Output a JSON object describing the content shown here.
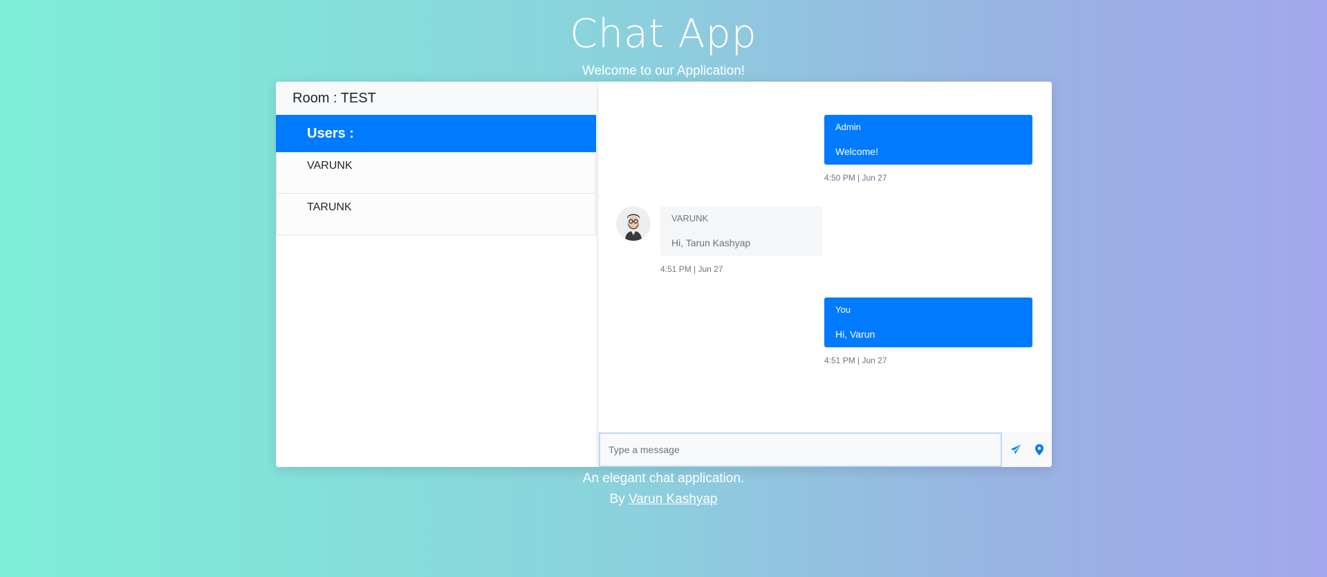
{
  "header": {
    "title": "Chat App",
    "subtitle": "Welcome to our Application!"
  },
  "sidebar": {
    "room_label": "Room : TEST",
    "users_label": "Users :",
    "users": [
      "VARUNK",
      "TARUNK"
    ]
  },
  "messages": [
    {
      "author": "Admin",
      "text": "Welcome!",
      "time": "4:50 PM | Jun 27",
      "direction": "outgoing"
    },
    {
      "author": "VARUNK",
      "text": "Hi, Tarun Kashyap",
      "time": "4:51 PM | Jun 27",
      "direction": "incoming",
      "avatar_icon": "bearded-man-avatar-icon"
    },
    {
      "author": "You",
      "text": "Hi, Varun",
      "time": "4:51 PM | Jun 27",
      "direction": "outgoing"
    }
  ],
  "composer": {
    "placeholder": "Type a message",
    "send_icon": "paper-plane-icon",
    "location_icon": "map-pin-icon"
  },
  "footer": {
    "tagline": "An elegant chat application.",
    "by_prefix": "By",
    "author_link": "Varun Kashyap"
  },
  "colors": {
    "accent": "#007bff",
    "gradient_start": "#7deed8",
    "gradient_end": "#a2a8eb"
  }
}
